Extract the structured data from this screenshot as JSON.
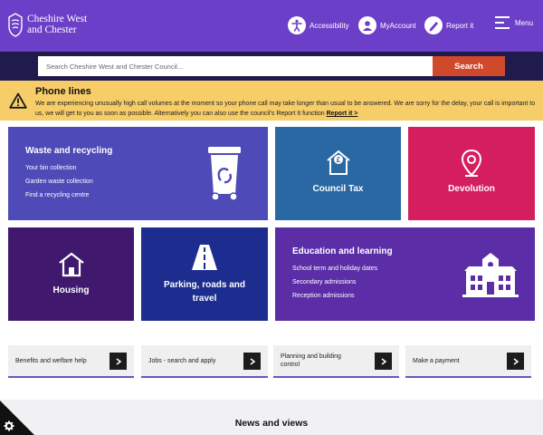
{
  "header": {
    "brand_line1": "Cheshire West",
    "brand_line2": "and Chester",
    "accessibility_label": "Accessibility",
    "myaccount_label": "MyAccount",
    "reportit_label": "Report it",
    "menu_label": "Menu"
  },
  "search": {
    "placeholder": "Search Cheshire West and Chester Council...",
    "button_label": "Search"
  },
  "alert": {
    "title": "Phone lines",
    "body": "We are experiencing unusually high call volumes at the moment so your phone call may take longer than usual to be answered. We are sorry for the delay, your call is important to us, we will get to you as soon as possible. Alternatively you can also use the council's Report It function",
    "link_label": "Report it >"
  },
  "tiles": {
    "waste": {
      "title": "Waste and recycling",
      "links": [
        "Your bin collection",
        "Garden waste collection",
        "Find a recycling centre"
      ]
    },
    "council_tax": {
      "title": "Council Tax"
    },
    "devolution": {
      "title": "Devolution"
    },
    "housing": {
      "title": "Housing"
    },
    "parking": {
      "title_line1": "Parking, roads and",
      "title_line2": "travel"
    },
    "education": {
      "title": "Education and learning",
      "links": [
        "School term and holiday dates",
        "Secondary admissions",
        "Reception admissions"
      ]
    }
  },
  "quick_links": [
    {
      "line1": "Benefits and welfare help",
      "line2": ""
    },
    {
      "line1": "Jobs - search and apply",
      "line2": ""
    },
    {
      "line1": "Planning and building",
      "line2": "control"
    },
    {
      "line1": "Make a payment",
      "line2": ""
    }
  ],
  "news": {
    "title": "News and views"
  },
  "colors": {
    "header": "#6b3fc7",
    "search_band": "#201b4d",
    "search_button": "#d0492b",
    "alert": "#f6cd68",
    "waste": "#4e4ab8",
    "council_tax": "#2a68a4",
    "devolution": "#d51e5e",
    "housing": "#40196f",
    "parking": "#1c2c8f",
    "education": "#5b2ea7"
  }
}
